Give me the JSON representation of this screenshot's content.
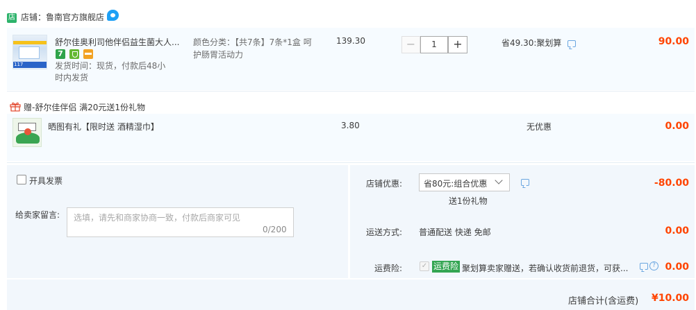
{
  "store": {
    "badge": "店",
    "label": "店铺：鲁南官方旗舰店"
  },
  "item": {
    "title": "舒尔佳奥利司他伴侣益生菌大人...",
    "thumb_number": "117",
    "service_seven": "7",
    "delivery": "发货时间：现货，付款后48小时内发货",
    "sku": "颜色分类：【共7条】7条*1盒 呵护肠胃活动力",
    "unit_price": "139.30",
    "qty_minus": "−",
    "quantity": "1",
    "qty_plus": "+",
    "promo": "省49.30:聚划算",
    "amount": "90.00"
  },
  "gift_group": {
    "label": "赠-舒尔佳伴侣    满20元送1份礼物",
    "title": "晒图有礼【限时送 酒精湿巾】",
    "unit_price": "3.80",
    "promo": "无优惠",
    "amount": "0.00"
  },
  "invoice": {
    "label": "开具发票"
  },
  "message": {
    "label": "给卖家留言:",
    "placeholder": "选填，请先和商家协商一致，付款后商家可见",
    "count": "0/200"
  },
  "store_discount": {
    "label": "店铺优惠:",
    "selected": "省80元:组合优惠",
    "note": "送1份礼物",
    "amount": "-80.00"
  },
  "shipping": {
    "label": "运送方式:",
    "value": "普通配送 快递 免邮",
    "amount": "0.00"
  },
  "insurance": {
    "label": "运费险:",
    "check": "✓",
    "tag": "运费险",
    "desc": "聚划算卖家赠送，若确认收货前退货，可获...",
    "help": "?",
    "amount": "0.00"
  },
  "total": {
    "label": "店铺合计(含运费)",
    "amount": "¥10.00"
  },
  "colors": {
    "accent": "#ff4400",
    "panel": "#f2f7fc",
    "item_bg": "#f6fbff",
    "link": "#1ea0f5"
  },
  "icons": [
    "store-badge-icon",
    "wangwang-chat-icon",
    "seven-day-return-icon",
    "shield-icon",
    "card-icon",
    "gift-icon",
    "chat-icon",
    "chevron-down-icon",
    "help-icon"
  ]
}
